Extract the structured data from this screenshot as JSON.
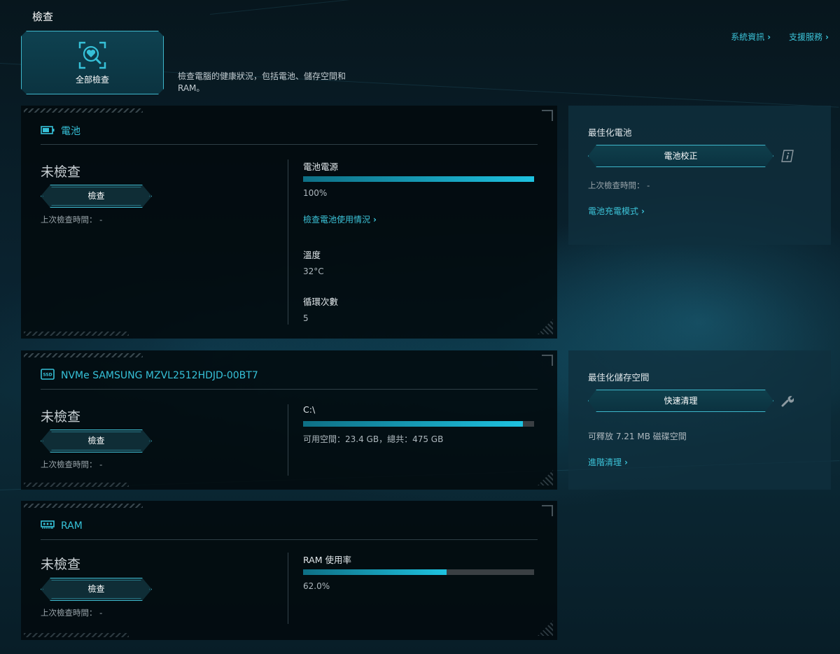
{
  "page": {
    "title": "檢查"
  },
  "top_links": {
    "system_info": "系統資訊",
    "support": "支援服務"
  },
  "full_check": {
    "label": "全部檢查",
    "description": "檢查電腦的健康狀況，包括電池、儲存空間和 RAM。"
  },
  "battery": {
    "title": "電池",
    "status": "未檢查",
    "check_label": "檢查",
    "last_check": "上次檢查時間： -",
    "power_label": "電池電源",
    "power_fraction": 1.0,
    "power_value": "100%",
    "usage_link": "檢查電池使用情況",
    "temp_label": "溫度",
    "temp_value": "32°C",
    "cycles_label": "循環次數",
    "cycles_value": "5"
  },
  "storage": {
    "title": "NVMe SAMSUNG MZVL2512HDJD-00BT7",
    "status": "未檢查",
    "check_label": "檢查",
    "last_check": "上次檢查時間： -",
    "drive_label": "C:\\",
    "used_fraction": 0.951,
    "space_text": "可用空間：23.4 GB，總共：475 GB"
  },
  "ram": {
    "title": "RAM",
    "status": "未檢查",
    "check_label": "檢查",
    "last_check": "上次檢查時間： -",
    "usage_label": "RAM 使用率",
    "usage_fraction": 0.62,
    "usage_value": "62.0%"
  },
  "optimize_battery": {
    "title": "最佳化電池",
    "button": "電池校正",
    "last_check": "上次檢查時間： -",
    "mode_link": "電池充電模式"
  },
  "optimize_storage": {
    "title": "最佳化儲存空間",
    "button": "快速清理",
    "releasable": "可釋放 7.21 MB 磁碟空間",
    "advanced_link": "進階清理"
  },
  "colors": {
    "accent": "#36c1d8",
    "bar_fill": "#1ec2e0",
    "bar_track": "#3a3f43",
    "card_bg": "#02090d",
    "side_bg": "#0f303e"
  }
}
